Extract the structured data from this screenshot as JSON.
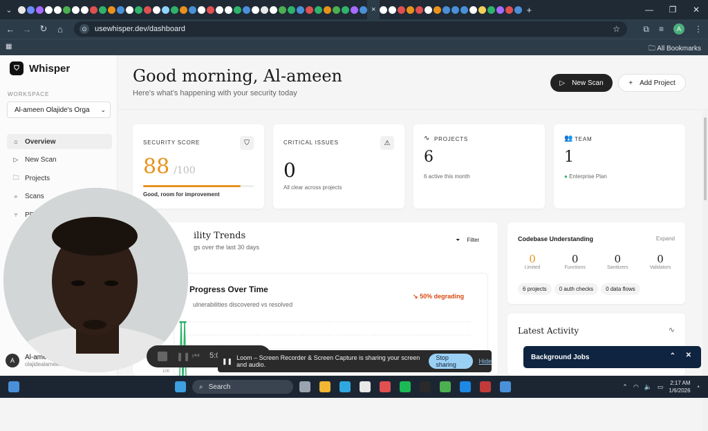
{
  "browser": {
    "active_tab_close": "×",
    "new_tab": "+",
    "url": "usewhisper.dev/dashboard",
    "profile_initial": "A",
    "all_bookmarks": "All Bookmarks"
  },
  "sidebar": {
    "app_name": "Whisper",
    "workspace_label": "WORKSPACE",
    "workspace_value": "Al-ameen Olajide's Orga",
    "items": [
      {
        "label": "Overview",
        "icon": "home-icon",
        "active": true
      },
      {
        "label": "New Scan",
        "icon": "play-icon"
      },
      {
        "label": "Projects",
        "icon": "folder-icon"
      },
      {
        "label": "Scans",
        "icon": "search-icon"
      },
      {
        "label": "PR",
        "icon": "pr-icon"
      }
    ],
    "user": {
      "initial": "A",
      "name": "Al-amee",
      "email": "olajidealameen"
    }
  },
  "header": {
    "greeting": "Good morning, Al-ameen",
    "subtitle": "Here's what's happening with your security today",
    "new_scan": "New Scan",
    "add_project": "Add Project"
  },
  "cards": {
    "security": {
      "label": "SECURITY SCORE",
      "value": "88",
      "max": "/100",
      "progress": 0.88,
      "note": "Good, room for improvement"
    },
    "critical": {
      "label": "CRITICAL ISSUES",
      "value": "0",
      "note": "All clear across projects"
    },
    "projects": {
      "label": "PROJECTS",
      "value": "6",
      "note": "6 active this month"
    },
    "team": {
      "label": "TEAM",
      "value": "1",
      "note": "Enterprise Plan"
    }
  },
  "trends": {
    "title": "ility Trends",
    "subtitle": "gs over the last 30 days",
    "filter": "Filter",
    "inner_title": "Progress Over Time",
    "inner_subtitle": "ulnerabilities discovered vs resolved",
    "degrading": "50% degrading",
    "y_tick": "100"
  },
  "codebase": {
    "title": "Codebase Understanding",
    "expand": "Expand",
    "stats": [
      {
        "value": "0",
        "label": "Limited"
      },
      {
        "value": "0",
        "label": "Functions"
      },
      {
        "value": "0",
        "label": "Sanitizers"
      },
      {
        "value": "0",
        "label": "Validators"
      }
    ],
    "pills": [
      "6 projects",
      "0 auth checks",
      "0 data flows"
    ]
  },
  "latest": {
    "title": "Latest Activity"
  },
  "overlay": {
    "timer": "5:0",
    "loom_text": "Loom – Screen Recorder & Screen Capture is sharing your screen and audio.",
    "stop_sharing": "Stop sharing",
    "hide": "Hide",
    "background_jobs": "Background Jobs"
  },
  "taskbar": {
    "search": "Search",
    "time": "2:17 AM",
    "date": "1/6/2026"
  },
  "colors": {
    "accent": "#e8921b",
    "dark": "#222222",
    "degrading": "#d9480f",
    "team_dot": "#2fb36b"
  }
}
